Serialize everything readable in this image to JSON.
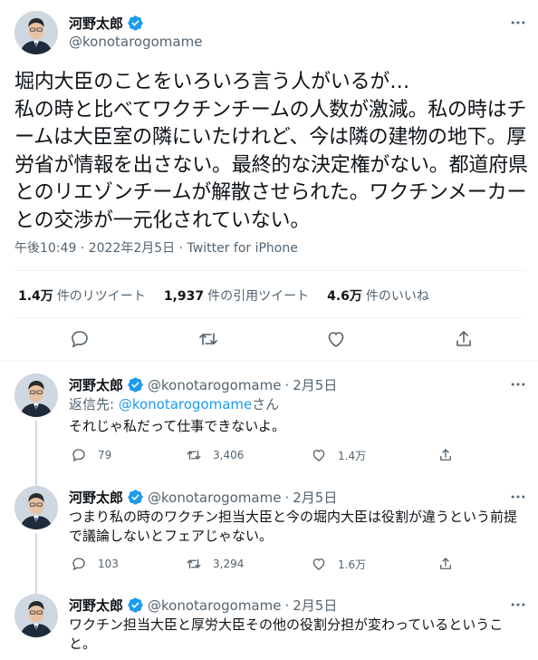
{
  "main_tweet": {
    "author_name": "河野太郎",
    "author_handle": "@konotarogomame",
    "text": "堀内大臣のことをいろいろ言う人がいるが…\n私の時と比べてワクチンチームの人数が激減。私の時はチームは大臣室の隣にいたけれど、今は隣の建物の地下。厚労省が情報を出さない。最終的な決定権がない。都道府県とのリエゾンチームが解散させられた。ワクチンメーカーとの交渉が一元化されていない。",
    "time": "午後10:49",
    "date": "2022年2月5日",
    "source": "Twitter for iPhone",
    "retweets_num": "1.4万",
    "retweets_label": "件のリツイート",
    "quotes_num": "1,937",
    "quotes_label": "件の引用ツイート",
    "likes_num": "4.6万",
    "likes_label": "件のいいね"
  },
  "replies": [
    {
      "author_name": "河野太郎",
      "author_handle": "@konotarogomame",
      "date": "2月5日",
      "reply_to_prefix": "返信先: ",
      "reply_to_handle": "@konotarogomame",
      "reply_to_suffix": "さん",
      "text": "それじゃ私だって仕事できないよ。",
      "reply_count": "79",
      "retweet_count": "3,406",
      "like_count": "1.4万"
    },
    {
      "author_name": "河野太郎",
      "author_handle": "@konotarogomame",
      "date": "2月5日",
      "text": "つまり私の時のワクチン担当大臣と今の堀内大臣は役割が違うという前提で議論しないとフェアじゃない。",
      "reply_count": "103",
      "retweet_count": "3,294",
      "like_count": "1.6万"
    },
    {
      "author_name": "河野太郎",
      "author_handle": "@konotarogomame",
      "date": "2月5日",
      "text": "ワクチン担当大臣と厚労大臣その他の役割分担が変わっているということ。"
    }
  ],
  "icons": {
    "verified": "verified-badge-icon",
    "more": "more-dots-icon",
    "reply": "reply-bubble-icon",
    "retweet": "retweet-arrows-icon",
    "like": "heart-icon",
    "share": "share-upload-icon"
  },
  "colors": {
    "accent": "#1d9bf0",
    "text": "#0f1419",
    "muted": "#536471",
    "divider": "#eff3f4"
  }
}
